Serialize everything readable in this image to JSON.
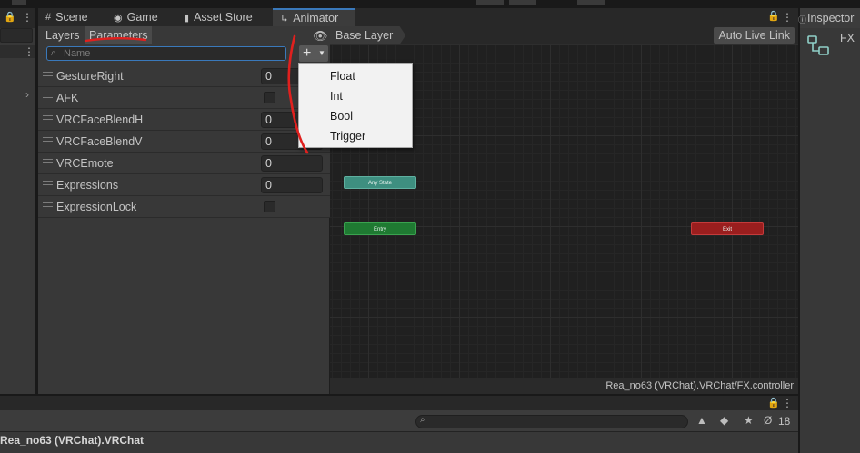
{
  "window_tabs": [
    {
      "label": "Scene",
      "icon": "grid-icon"
    },
    {
      "label": "Game",
      "icon": "gamepad-icon"
    },
    {
      "label": "Asset Store",
      "icon": "shopping-bag-icon"
    },
    {
      "label": "Animator",
      "icon": "animator-icon",
      "active": true
    }
  ],
  "subtabs": {
    "layers": "Layers",
    "parameters": "Parameters"
  },
  "search": {
    "placeholder": "Name"
  },
  "parameters": [
    {
      "name": "GestureRight",
      "kind": "number",
      "value": "0"
    },
    {
      "name": "AFK",
      "kind": "bool",
      "value": ""
    },
    {
      "name": "VRCFaceBlendH",
      "kind": "number",
      "value": "0"
    },
    {
      "name": "VRCFaceBlendV",
      "kind": "number",
      "value": "0"
    },
    {
      "name": "VRCEmote",
      "kind": "number",
      "value": "0"
    },
    {
      "name": "Expressions",
      "kind": "number",
      "value": "0"
    },
    {
      "name": "ExpressionLock",
      "kind": "bool",
      "value": ""
    }
  ],
  "add_menu": {
    "items": [
      "Float",
      "Int",
      "Bool",
      "Trigger"
    ]
  },
  "graph": {
    "breadcrumb": "Base Layer",
    "auto_live_link": "Auto Live Link",
    "nodes": {
      "any_state": "Any State",
      "entry": "Entry",
      "exit": "Exit"
    },
    "controller_path": "Rea_no63 (VRChat).VRChat/FX.controller",
    "colors": {
      "any_state": "#3e8f80",
      "entry": "#1f7a32",
      "exit": "#9a1e1e",
      "background": "#202020"
    }
  },
  "inspector": {
    "tab_label": "Inspector",
    "object_name": "FX"
  },
  "bottom_panel": {
    "title": "Rea_no63 (VRChat).VRChat",
    "hidden_count": "18"
  },
  "annotation": {
    "color": "#e0201e"
  }
}
